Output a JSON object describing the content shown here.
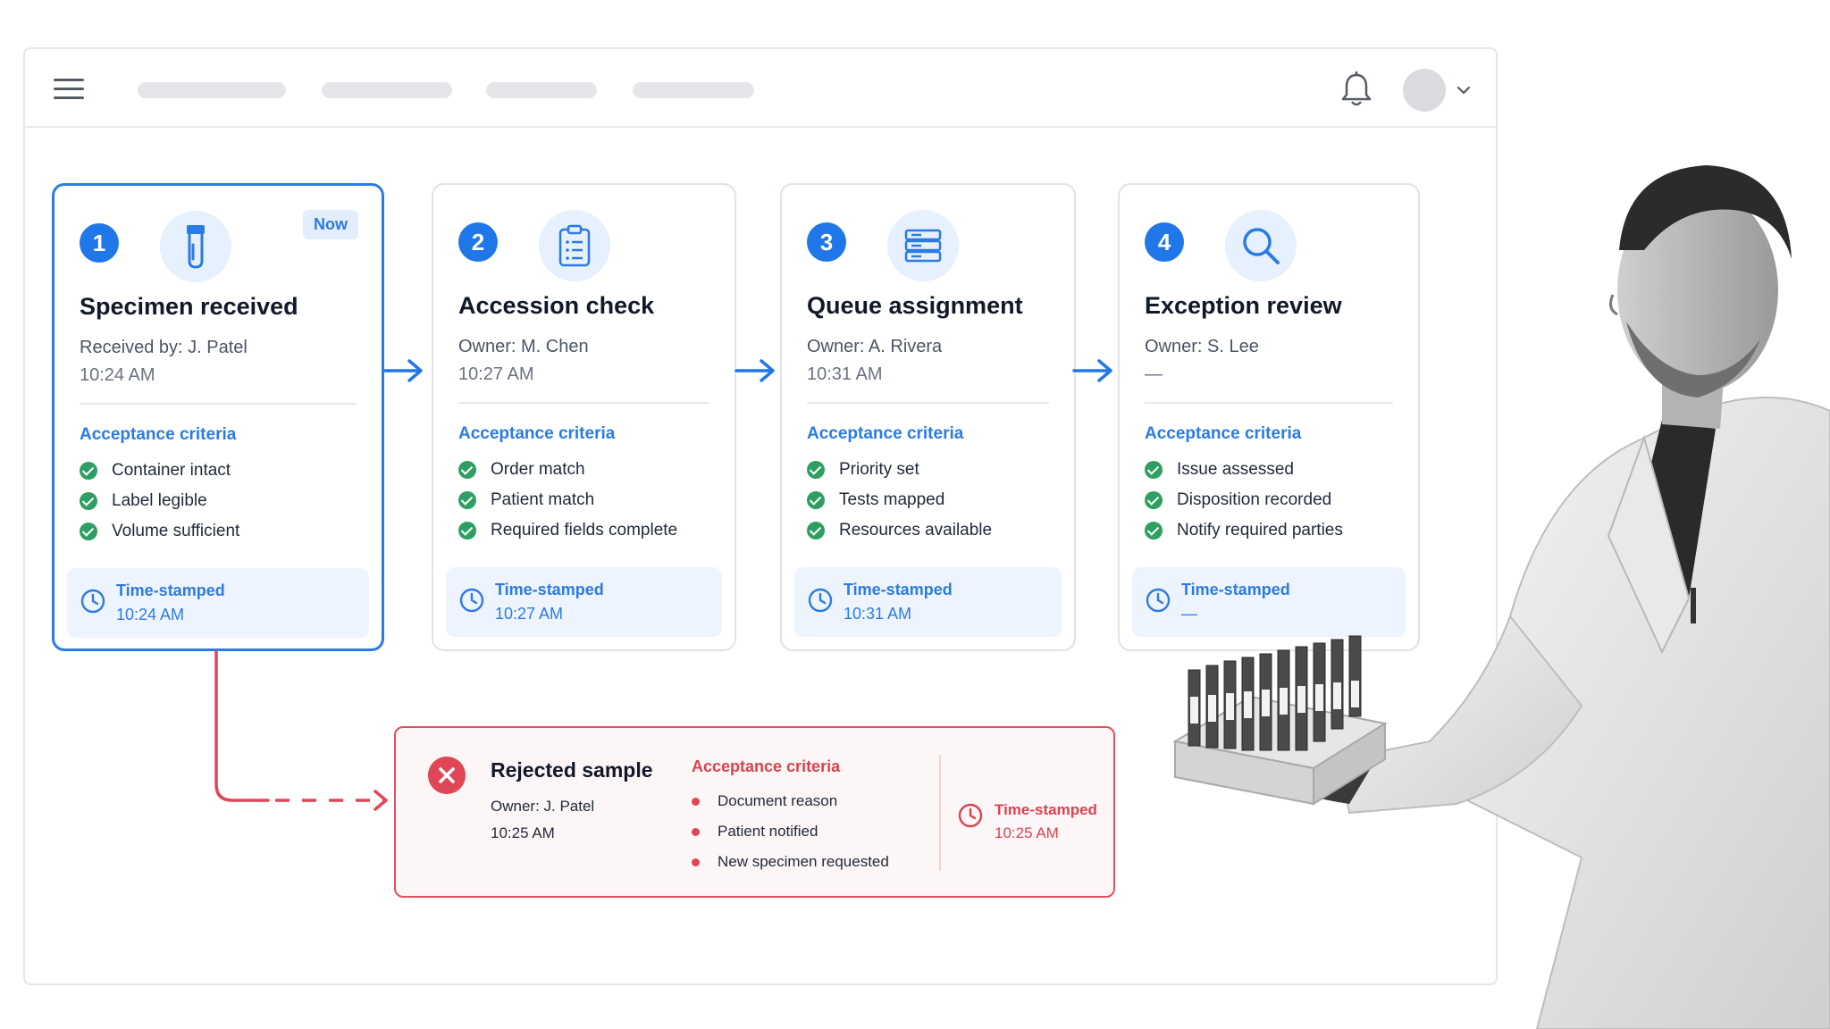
{
  "header": {
    "menu_icon": "hamburger-icon",
    "notification_icon": "bell-icon",
    "avatar_icon": "user-avatar",
    "dropdown_icon": "chevron-down-icon"
  },
  "steps": [
    {
      "number": "1",
      "icon": "test-tube-icon",
      "badge": "Now",
      "title": "Specimen received",
      "owner": "Received by: J. Patel",
      "time": "10:24 AM",
      "criteria_title": "Acceptance criteria",
      "criteria": [
        "Container intact",
        "Label legible",
        "Volume sufficient"
      ],
      "stamp_label": "Time-stamped",
      "stamp_time": "10:24 AM"
    },
    {
      "number": "2",
      "icon": "clipboard-icon",
      "title": "Accession check",
      "owner": "Owner: M. Chen",
      "time": "10:27 AM",
      "criteria_title": "Acceptance criteria",
      "criteria": [
        "Order match",
        "Patient match",
        "Required fields complete"
      ],
      "stamp_label": "Time-stamped",
      "stamp_time": "10:27 AM"
    },
    {
      "number": "3",
      "icon": "server-rack-icon",
      "title": "Queue assignment",
      "owner": "Owner: A. Rivera",
      "time": "10:31 AM",
      "criteria_title": "Acceptance criteria",
      "criteria": [
        "Priority set",
        "Tests mapped",
        "Resources available"
      ],
      "stamp_label": "Time-stamped",
      "stamp_time": "10:31 AM"
    },
    {
      "number": "4",
      "icon": "magnifier-icon",
      "title": "Exception review",
      "owner": "Owner: S. Lee",
      "time": "—",
      "criteria_title": "Acceptance criteria",
      "criteria": [
        "Issue assessed",
        "Disposition recorded",
        "Notify required parties"
      ],
      "stamp_label": "Time-stamped",
      "stamp_time": "—"
    }
  ],
  "rejected": {
    "icon": "close-circle-icon",
    "title": "Rejected sample",
    "owner": "Owner: J. Patel",
    "time": "10:25 AM",
    "criteria_title": "Acceptance criteria",
    "criteria": [
      "Document reason",
      "Patient notified",
      "New specimen requested"
    ],
    "stamp_label": "Time-stamped",
    "stamp_time": "10:25 AM"
  },
  "colors": {
    "accent_blue": "#1f77e8",
    "success_green": "#2f9e62",
    "reject_red": "#e04656"
  }
}
